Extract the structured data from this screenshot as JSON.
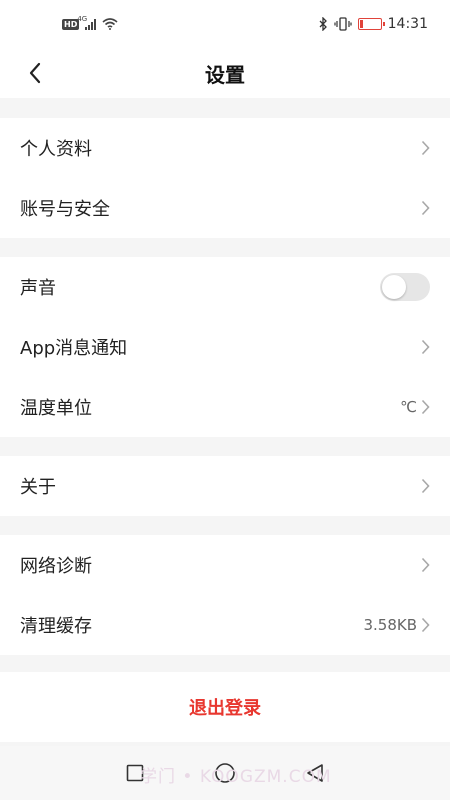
{
  "status_bar": {
    "network_badge": "HD",
    "network_type": "4G",
    "time": "14:31",
    "battery_color": "#e0433a"
  },
  "header": {
    "title": "设置",
    "back_icon": "chevron-left-icon"
  },
  "groups": [
    [
      {
        "label": "个人资料",
        "type": "link"
      },
      {
        "label": "账号与安全",
        "type": "link"
      }
    ],
    [
      {
        "label": "声音",
        "type": "toggle",
        "enabled": false
      },
      {
        "label": "App消息通知",
        "type": "link"
      },
      {
        "label": "温度单位",
        "type": "link",
        "value": "℃"
      }
    ],
    [
      {
        "label": "关于",
        "type": "link"
      }
    ],
    [
      {
        "label": "网络诊断",
        "type": "link"
      },
      {
        "label": "清理缓存",
        "type": "link",
        "value": "3.58KB"
      }
    ]
  ],
  "logout": {
    "label": "退出登录",
    "color": "#e8372f"
  },
  "watermark": "学门 • KOOGZM.COM",
  "colors": {
    "background": "#f5f5f5",
    "surface": "#ffffff",
    "accent": "#e8372f",
    "toggle_off": "#e6e6e6"
  }
}
